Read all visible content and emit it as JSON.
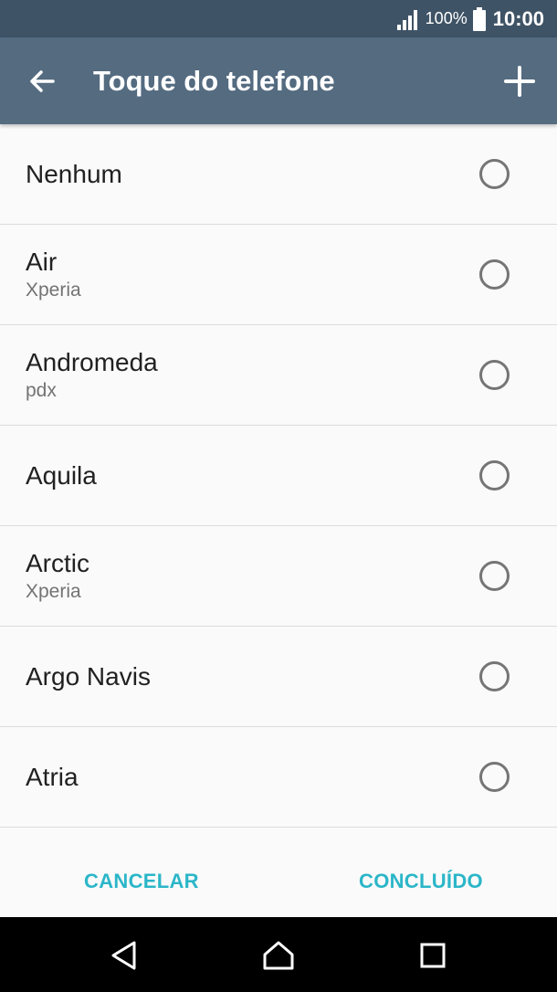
{
  "status_bar": {
    "battery_percent": "100%",
    "time": "10:00",
    "icons": [
      "signal-icon",
      "battery-icon"
    ]
  },
  "app_bar": {
    "title": "Toque do telefone",
    "icons": [
      "back-arrow-icon",
      "plus-icon"
    ]
  },
  "ringtones": [
    {
      "name": "Nenhum",
      "sub": "",
      "selected": false
    },
    {
      "name": "Air",
      "sub": "Xperia",
      "selected": false
    },
    {
      "name": "Andromeda",
      "sub": "pdx",
      "selected": false
    },
    {
      "name": "Aquila",
      "sub": "",
      "selected": false
    },
    {
      "name": "Arctic",
      "sub": "Xperia",
      "selected": false
    },
    {
      "name": "Argo Navis",
      "sub": "",
      "selected": false
    },
    {
      "name": "Atria",
      "sub": "",
      "selected": false
    }
  ],
  "actions": {
    "cancel_label": "CANCELAR",
    "done_label": "CONCLUÍDO",
    "accent_color": "#2bb6c8"
  },
  "nav_bar": {
    "icons": [
      "back-triangle-icon",
      "home-icon",
      "recent-apps-icon"
    ]
  }
}
